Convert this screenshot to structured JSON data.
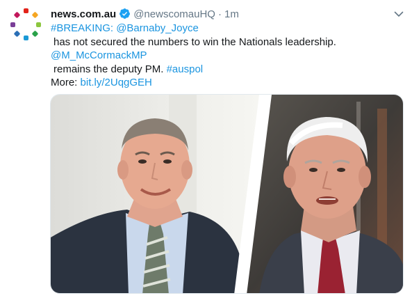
{
  "account": {
    "display_name": "news.com.au",
    "handle": "@newscomauHQ",
    "separator": "·",
    "time": "1m",
    "avatar_icon": "news-logo-icon",
    "verified_icon": "verified-badge-icon"
  },
  "tweet": {
    "line1_hashtag": "#BREAKING:",
    "line1_mention": "@Barnaby_Joyce",
    "line2": "has not secured the numbers to win the Nationals leadership.",
    "line3_mention": "@M_McCormackMP",
    "line4_text": "remains the deputy PM.",
    "line4_hashtag": "#auspol",
    "line5_label": "More:",
    "line5_link": "bit.ly/2UqgGEH"
  },
  "menu": {
    "icon": "chevron-down-icon"
  },
  "colors": {
    "link": "#1b95e0",
    "text": "#14171a",
    "muted": "#657786",
    "verified": "#1da1f2"
  }
}
